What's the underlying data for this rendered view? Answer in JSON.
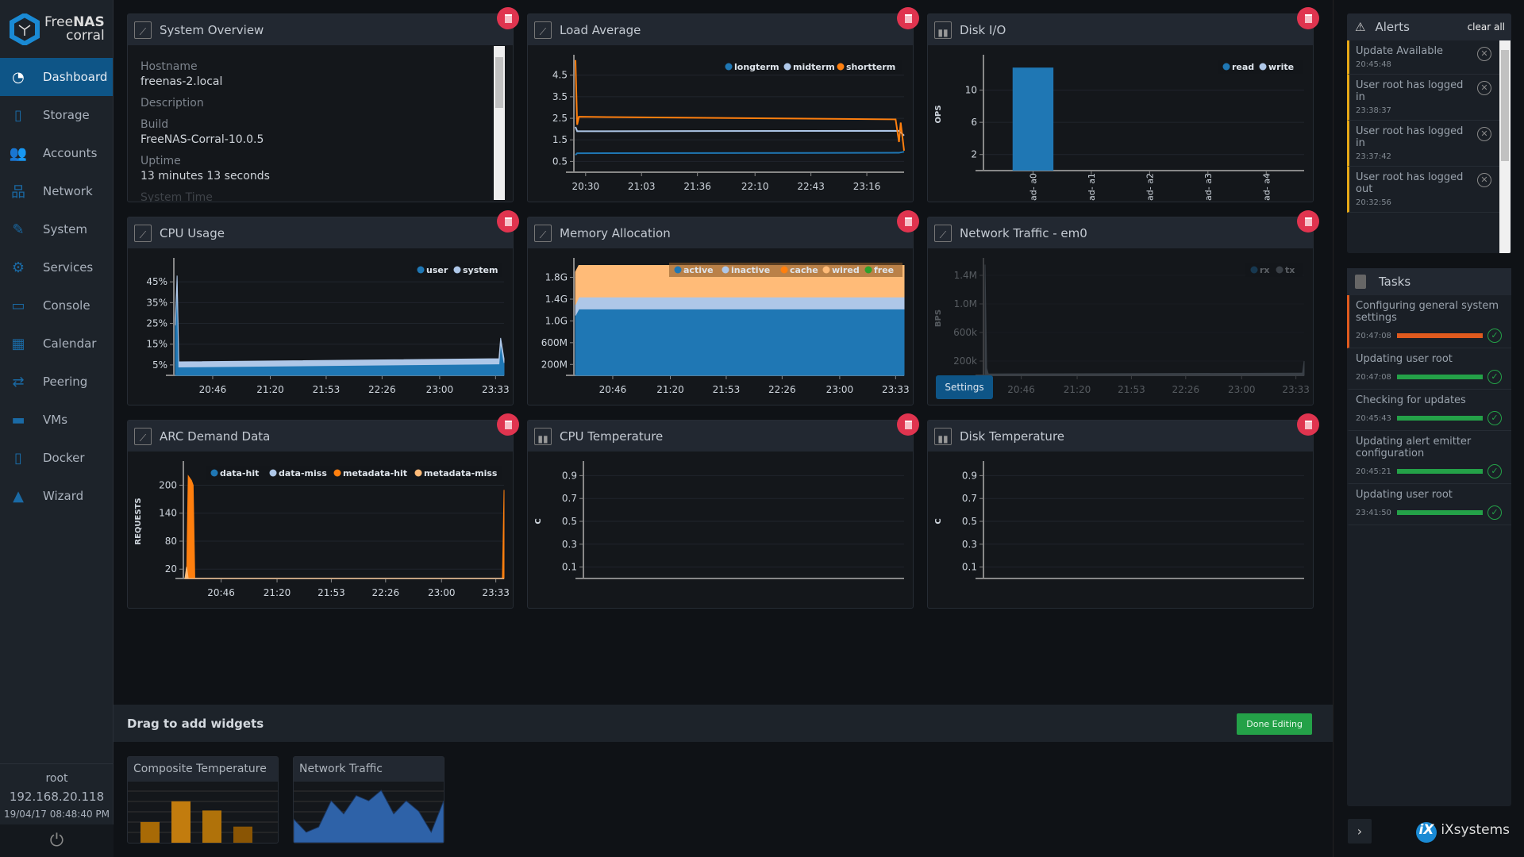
{
  "brand": {
    "name_light": "Free",
    "name_bold": "NAS",
    "sub": "corral"
  },
  "sidebar": {
    "items": [
      {
        "label": "Dashboard",
        "icon": "dashboard-icon",
        "glyph": "◔",
        "active": true
      },
      {
        "label": "Storage",
        "icon": "storage-icon",
        "glyph": "▯"
      },
      {
        "label": "Accounts",
        "icon": "accounts-icon",
        "glyph": "👥"
      },
      {
        "label": "Network",
        "icon": "network-icon",
        "glyph": "品"
      },
      {
        "label": "System",
        "icon": "wrench-icon",
        "glyph": "✎"
      },
      {
        "label": "Services",
        "icon": "gears-icon",
        "glyph": "⚙"
      },
      {
        "label": "Console",
        "icon": "console-icon",
        "glyph": "▭"
      },
      {
        "label": "Calendar",
        "icon": "calendar-icon",
        "glyph": "▦"
      },
      {
        "label": "Peering",
        "icon": "peering-icon",
        "glyph": "⇄"
      },
      {
        "label": "VMs",
        "icon": "monitor-icon",
        "glyph": "▬"
      },
      {
        "label": "Docker",
        "icon": "docker-icon",
        "glyph": "▯"
      },
      {
        "label": "Wizard",
        "icon": "wizard-hat-icon",
        "glyph": "▲"
      }
    ],
    "user": "root",
    "ip": "192.168.20.118",
    "datetime": "19/04/17 08:48:40 PM"
  },
  "overview": {
    "title": "System Overview",
    "fields": [
      {
        "k": "Hostname",
        "v": "freenas-2.local"
      },
      {
        "k": "Description",
        "v": ""
      },
      {
        "k": "Build",
        "v": "FreeNAS-Corral-10.0.5"
      },
      {
        "k": "Uptime",
        "v": "13 minutes 13 seconds"
      },
      {
        "k": "System Time",
        "v": ""
      }
    ]
  },
  "widgets": {
    "load": "Load Average",
    "disk_io": "Disk I/O",
    "cpu": "CPU Usage",
    "mem": "Memory Allocation",
    "net": "Network Traffic - em0",
    "arc": "ARC Demand Data",
    "cpu_temp": "CPU Temperature",
    "disk_temp": "Disk Temperature",
    "settings_label": "Settings"
  },
  "chart_data": [
    {
      "id": "load",
      "type": "line",
      "xlim": [
        "20:24",
        "23:38"
      ],
      "xticks": [
        "20:30",
        "21:03",
        "21:36",
        "22:10",
        "22:43",
        "23:16"
      ],
      "ylim": [
        0,
        5.3
      ],
      "yticks": [
        {
          "v": 0.5,
          "l": "0.5"
        },
        {
          "v": 1.5,
          "l": "1.5"
        },
        {
          "v": 2.5,
          "l": "2.5"
        },
        {
          "v": 3.5,
          "l": "3.5"
        },
        {
          "v": 4.5,
          "l": "4.5"
        }
      ],
      "ylabel": "",
      "series": [
        {
          "name": "longterm",
          "color": "#1f77b4",
          "points": [
            [
              "20:24",
              0.8
            ],
            [
              "20:25",
              0.88
            ],
            [
              "23:35",
              0.9
            ],
            [
              "23:38",
              0.95
            ]
          ]
        },
        {
          "name": "midterm",
          "color": "#aec7e8",
          "points": [
            [
              "20:24",
              2.1
            ],
            [
              "20:25",
              1.9
            ],
            [
              "23:35",
              1.92
            ],
            [
              "23:38",
              1.7
            ]
          ]
        },
        {
          "name": "shortterm",
          "color": "#ff7f0e",
          "points": [
            [
              "20:24",
              5.2
            ],
            [
              "20:25",
              2.2
            ],
            [
              "20:26",
              2.57
            ],
            [
              "23:33",
              2.45
            ],
            [
              "23:35",
              1.4
            ],
            [
              "23:36",
              2.3
            ],
            [
              "23:38",
              1.0
            ]
          ]
        }
      ]
    },
    {
      "id": "disk_io",
      "type": "bar",
      "categories": [
        "ad- a0",
        "ad- a1",
        "ad- a2",
        "ad- a3",
        "ad- a4"
      ],
      "ylim": [
        0,
        14
      ],
      "yticks": [
        {
          "v": 2,
          "l": "2"
        },
        {
          "v": 6,
          "l": "6"
        },
        {
          "v": 10,
          "l": "10"
        }
      ],
      "ylabel": "OPS",
      "series": [
        {
          "name": "read",
          "color": "#1f77b4",
          "values": [
            12.8,
            0,
            0,
            0,
            0
          ]
        },
        {
          "name": "write",
          "color": "#aec7e8",
          "values": [
            0,
            0,
            0,
            0,
            0
          ]
        }
      ]
    },
    {
      "id": "cpu",
      "type": "stacked-area",
      "xlim": [
        "20:24",
        "23:38"
      ],
      "xticks": [
        "20:46",
        "21:20",
        "21:53",
        "22:26",
        "23:00",
        "23:33"
      ],
      "ylim": [
        0,
        55
      ],
      "yticks": [
        {
          "v": 5,
          "l": "5%"
        },
        {
          "v": 15,
          "l": "15%"
        },
        {
          "v": 25,
          "l": "25%"
        },
        {
          "v": 35,
          "l": "35%"
        },
        {
          "v": 45,
          "l": "45%"
        }
      ],
      "ylabel": "",
      "x": [
        "20:24",
        "20:25",
        "20:26",
        "23:35",
        "23:36",
        "23:38"
      ],
      "series": [
        {
          "name": "user",
          "color": "#1f77b4",
          "values": [
            24,
            45,
            4,
            5.5,
            16,
            6
          ]
        },
        {
          "name": "system",
          "color": "#aec7e8",
          "values": [
            3,
            3,
            2.5,
            2.5,
            2,
            2
          ]
        }
      ]
    },
    {
      "id": "mem",
      "type": "stacked-area",
      "xlim": [
        "20:24",
        "23:38"
      ],
      "xticks": [
        "20:46",
        "21:20",
        "21:53",
        "22:26",
        "23:00",
        "23:33"
      ],
      "ylim": [
        0,
        2.1
      ],
      "yticks": [
        {
          "v": 0.2,
          "l": "200M"
        },
        {
          "v": 0.6,
          "l": "600M"
        },
        {
          "v": 1.0,
          "l": "1.0G"
        },
        {
          "v": 1.4,
          "l": "1.4G"
        },
        {
          "v": 1.8,
          "l": "1.8G"
        }
      ],
      "ylabel": "",
      "x": [
        "20:24",
        "20:26",
        "23:38"
      ],
      "series": [
        {
          "name": "active",
          "color": "#1f77b4",
          "values": [
            1.1,
            1.22,
            1.22
          ]
        },
        {
          "name": "inactive",
          "color": "#aec7e8",
          "values": [
            0.2,
            0.22,
            0.22
          ]
        },
        {
          "name": "cache",
          "color": "#ff7f0e",
          "values": [
            0,
            0,
            0
          ]
        },
        {
          "name": "wired",
          "color": "#ffbb78",
          "values": [
            0.6,
            0.58,
            0.58
          ]
        },
        {
          "name": "free",
          "color": "#2ca02c",
          "values": [
            0,
            0,
            0
          ]
        }
      ]
    },
    {
      "id": "net",
      "type": "stacked-area",
      "dimmed": true,
      "xlim": [
        "20:24",
        "23:38"
      ],
      "xticks": [
        "20:46",
        "21:20",
        "21:53",
        "22:26",
        "23:00",
        "23:33"
      ],
      "ylim": [
        0,
        1.6
      ],
      "yticks": [
        {
          "v": 0.2,
          "l": "200k"
        },
        {
          "v": 0.6,
          "l": "600k"
        },
        {
          "v": 1.0,
          "l": "1.0M"
        },
        {
          "v": 1.4,
          "l": "1.4M"
        }
      ],
      "ylabel": "BPS",
      "x": [
        "20:24",
        "20:25",
        "20:26",
        "23:36",
        "23:37",
        "23:38"
      ],
      "series": [
        {
          "name": "rx",
          "color": "#1f77b4",
          "values": [
            0,
            0,
            0,
            0,
            0,
            0
          ]
        },
        {
          "name": "tx",
          "color": "#7f8a96",
          "values": [
            1.55,
            0.1,
            0.02,
            0.03,
            0.03,
            0.2
          ]
        }
      ]
    },
    {
      "id": "arc",
      "type": "area",
      "xlim": [
        "20:24",
        "23:38"
      ],
      "xticks": [
        "20:46",
        "21:20",
        "21:53",
        "22:26",
        "23:00",
        "23:33"
      ],
      "ylim": [
        0,
        245
      ],
      "yticks": [
        {
          "v": 20,
          "l": "20"
        },
        {
          "v": 80,
          "l": "80"
        },
        {
          "v": 140,
          "l": "140"
        },
        {
          "v": 200,
          "l": "200"
        }
      ],
      "ylabel": "REQUESTS",
      "series": [
        {
          "name": "data-hit",
          "color": "#1f77b4",
          "points": [
            [
              "20:24",
              0
            ],
            [
              "23:38",
              0
            ]
          ]
        },
        {
          "name": "data-miss",
          "color": "#aec7e8",
          "points": [
            [
              "20:24",
              0
            ],
            [
              "23:38",
              0
            ]
          ]
        },
        {
          "name": "metadata-hit",
          "color": "#ff7f0e",
          "points": [
            [
              "20:25",
              0
            ],
            [
              "20:26",
              220
            ],
            [
              "20:28",
              210
            ],
            [
              "20:29",
              200
            ],
            [
              "20:30",
              0
            ],
            [
              "23:37",
              0
            ],
            [
              "23:38",
              190
            ]
          ]
        },
        {
          "name": "metadata-miss",
          "color": "#ffbb78",
          "points": [
            [
              "20:24",
              0
            ],
            [
              "20:25",
              25
            ],
            [
              "20:26",
              0
            ],
            [
              "23:38",
              0
            ]
          ]
        }
      ]
    },
    {
      "id": "cpu_temp",
      "type": "line",
      "xlim": [
        "20:24",
        "23:38"
      ],
      "xticks": [],
      "ylim": [
        0,
        1
      ],
      "yticks": [
        {
          "v": 0.1,
          "l": "0.1"
        },
        {
          "v": 0.3,
          "l": "0.3"
        },
        {
          "v": 0.5,
          "l": "0.5"
        },
        {
          "v": 0.7,
          "l": "0.7"
        },
        {
          "v": 0.9,
          "l": "0.9"
        }
      ],
      "ylabel": "C",
      "series": []
    },
    {
      "id": "disk_temp",
      "type": "line",
      "xlim": [
        "20:24",
        "23:38"
      ],
      "xticks": [],
      "ylim": [
        0,
        1
      ],
      "yticks": [
        {
          "v": 0.1,
          "l": "0.1"
        },
        {
          "v": 0.3,
          "l": "0.3"
        },
        {
          "v": 0.5,
          "l": "0.5"
        },
        {
          "v": 0.7,
          "l": "0.7"
        },
        {
          "v": 0.9,
          "l": "0.9"
        }
      ],
      "ylabel": "C",
      "series": []
    }
  ],
  "drawer": {
    "title": "Drag to add widgets",
    "done": "Done Editing",
    "thumbs": [
      {
        "label": "Composite Temperature",
        "preview": [
          0.45,
          0.9,
          0.7,
          0.35
        ]
      },
      {
        "label": "Network Traffic",
        "preview": [
          0.45,
          0.2,
          0.3,
          0.8,
          0.55,
          0.9,
          0.8,
          1.0,
          0.55,
          0.8,
          0.6,
          0.2,
          0.8
        ]
      }
    ]
  },
  "alerts": {
    "title": "Alerts",
    "clear": "clear all",
    "items": [
      {
        "text": "Update Available",
        "time": "20:45:48"
      },
      {
        "text": "User root has logged in",
        "time": "23:38:37"
      },
      {
        "text": "User root has logged in",
        "time": "23:37:42"
      },
      {
        "text": "User root has logged out",
        "time": "20:32:56"
      }
    ]
  },
  "tasks": {
    "title": "Tasks",
    "items": [
      {
        "text": "Configuring general system settings",
        "time": "20:47:08",
        "progress": 100,
        "color": "#e05a1e"
      },
      {
        "text": "Updating user root",
        "time": "20:47:08",
        "progress": 100,
        "color": "#24a148"
      },
      {
        "text": "Checking for updates",
        "time": "20:45:43",
        "progress": 100,
        "color": "#24a148"
      },
      {
        "text": "Updating alert emitter configuration",
        "time": "20:45:21",
        "progress": 100,
        "color": "#24a148"
      },
      {
        "text": "Updating user root",
        "time": "23:41:50",
        "progress": 100,
        "color": "#24a148"
      }
    ]
  },
  "footer": {
    "vendor": "iXsystems"
  }
}
